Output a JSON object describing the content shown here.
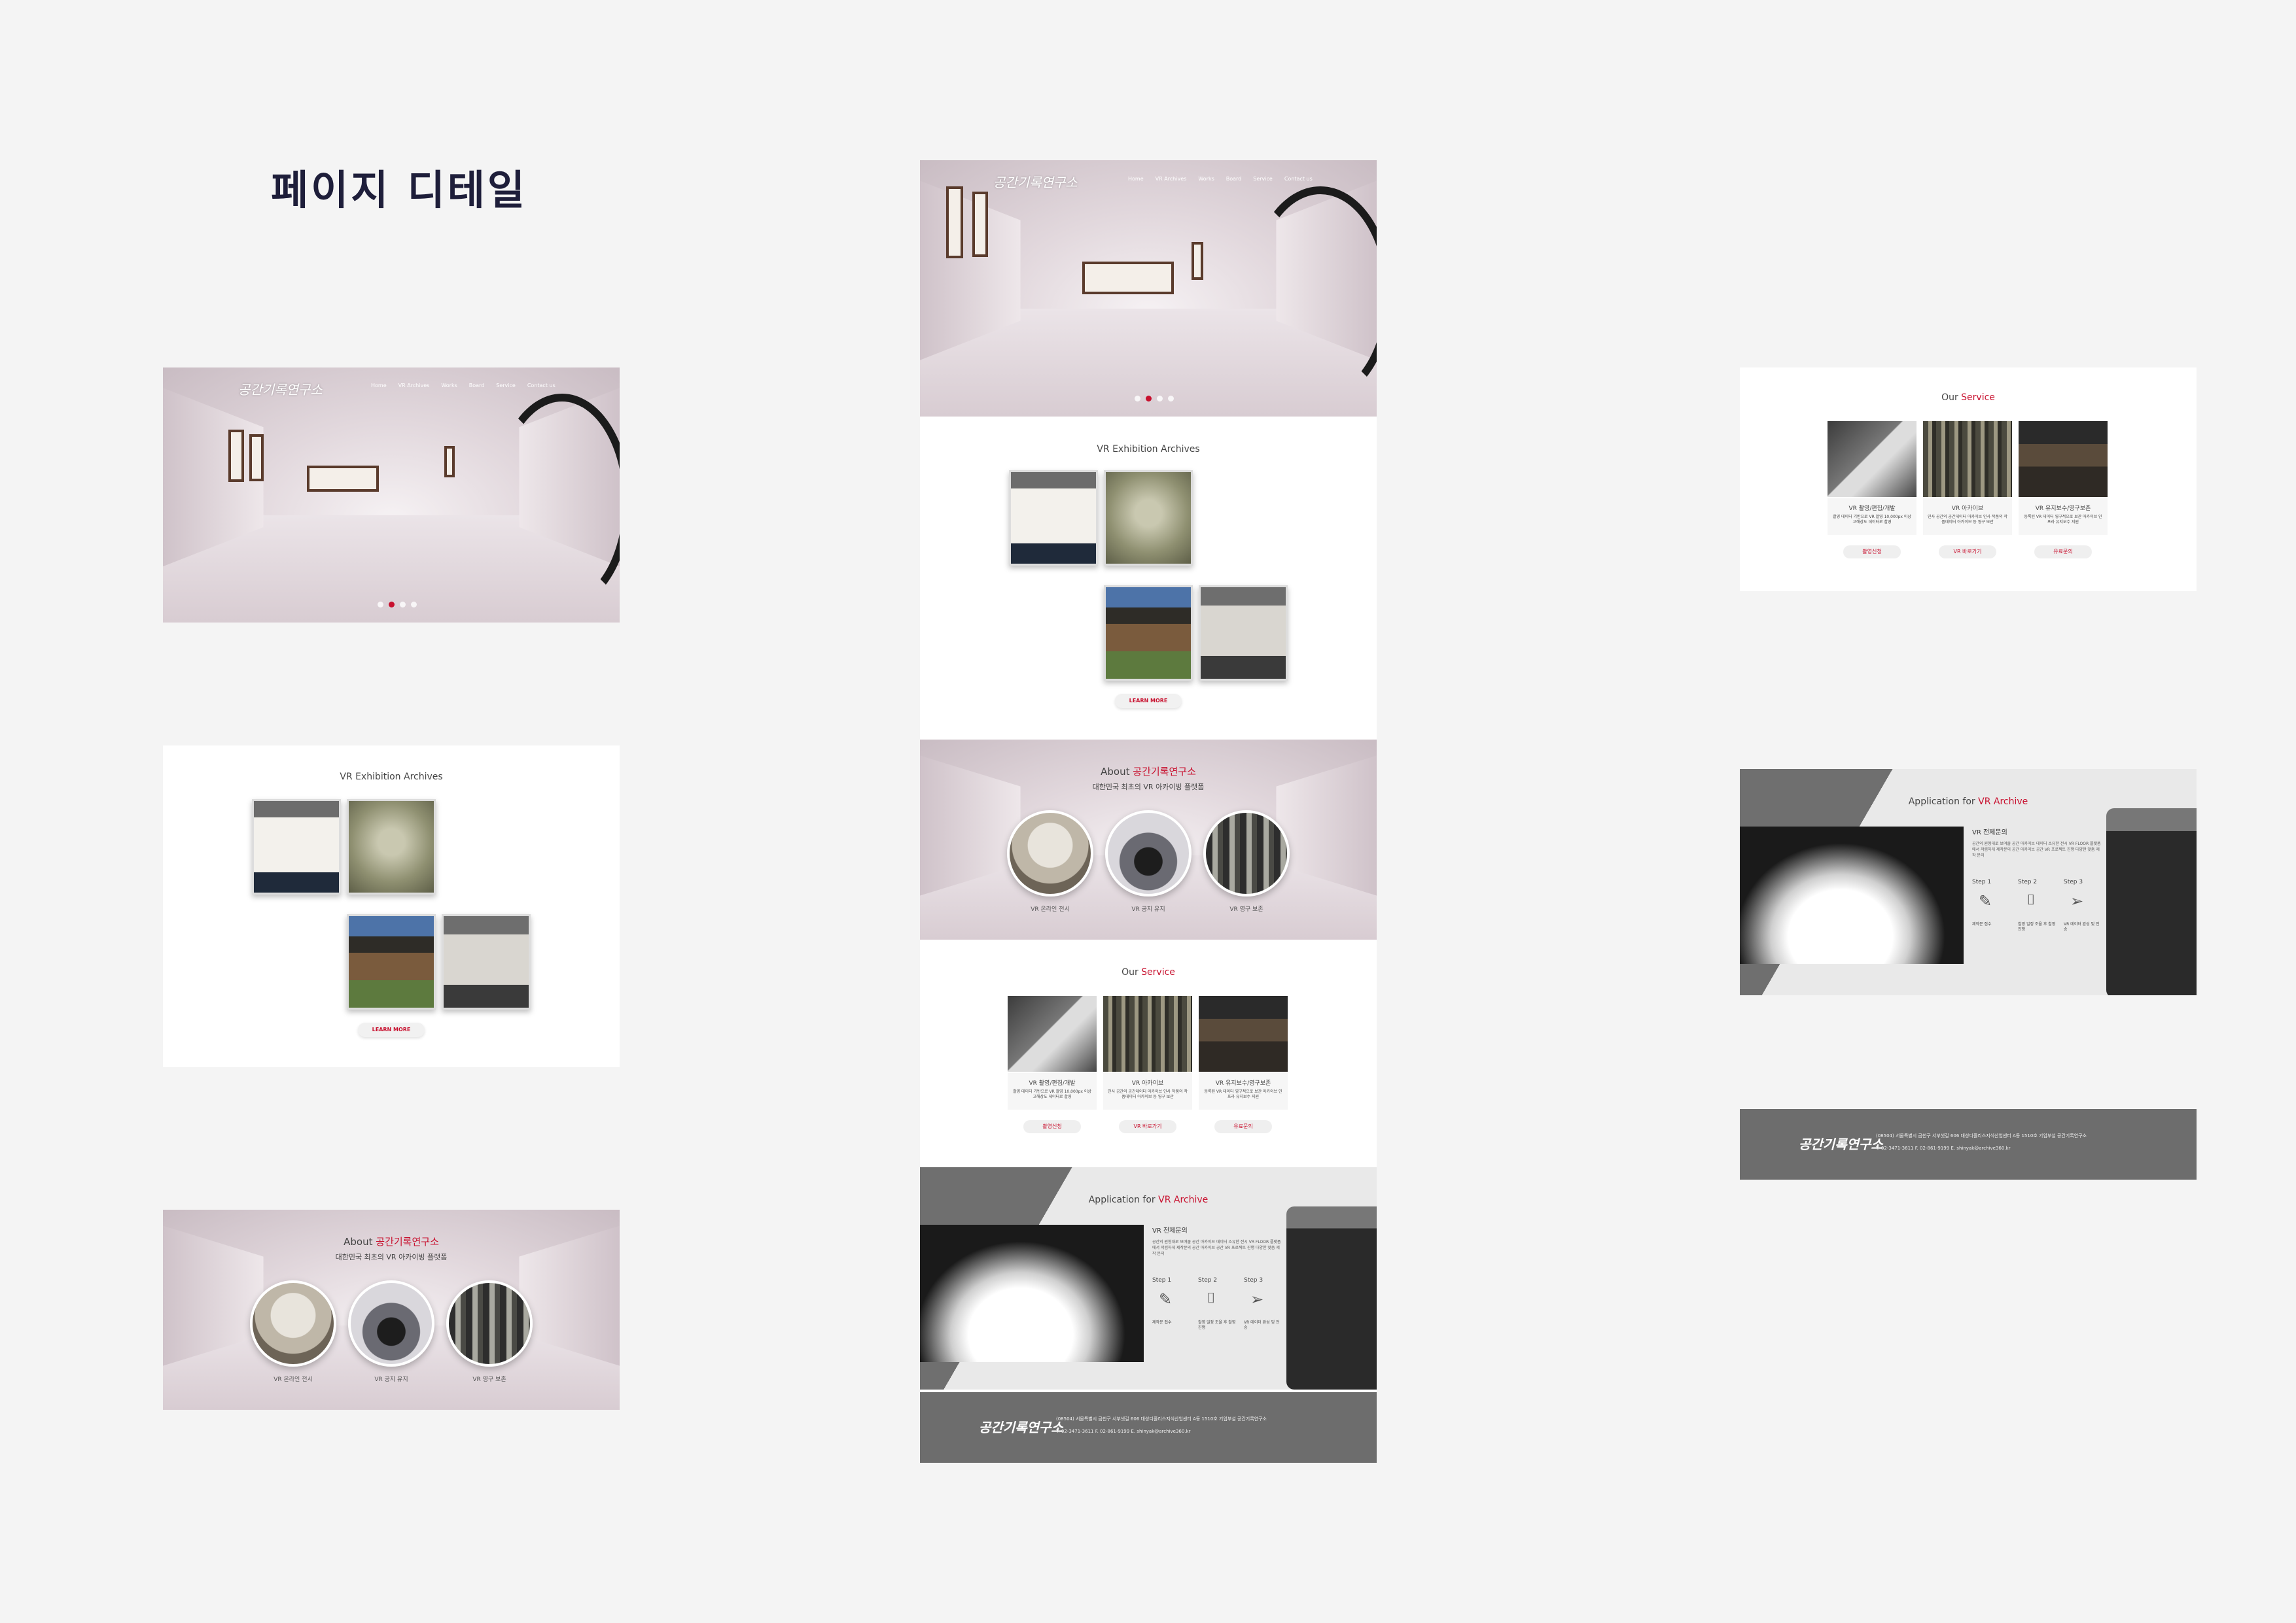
{
  "page_title": "페이지 디테일",
  "brand": {
    "logo": "공간기록연구소",
    "accent": "#c8102e",
    "footer_bg": "#6d6d6d"
  },
  "nav": [
    "Home",
    "VR Archives",
    "Works",
    "Board",
    "Service",
    "Contact us"
  ],
  "vr_section": {
    "title": "VR Exhibition Archives",
    "button": "LEARN MORE"
  },
  "about": {
    "title_prefix": "About",
    "title_highlight": "공간기록연구소",
    "subtitle": "대한민국 최초의 VR 아카이빙 플랫폼",
    "circles": [
      "VR 온라인 전시",
      "VR 공지 유지",
      "VR 영구 보존"
    ]
  },
  "service": {
    "title_prefix": "Our",
    "title_highlight": "Service",
    "items": [
      {
        "name": "VR 촬영/편집/개발",
        "desc": "촬영 데이터 기반으로 VR 촬영 10,000px 이상 고해상도 데이터로 촬영",
        "button": "촬영신청"
      },
      {
        "name": "VR 아카이브",
        "desc": "인사 공간의 공간데이터 아카이브 인사 작품의 작품데이터 아카이브 등 영구 보관",
        "button": "VR 바로가기"
      },
      {
        "name": "VR 유지보수/영구보존",
        "desc": "등록된 VR 데이터 영구적으로 보관 아카이브 인프라 유지보수 지원",
        "button": "유료문의"
      }
    ]
  },
  "application": {
    "title_prefix": "Application for",
    "title_highlight": "VR Archive",
    "subtitle": "VR 전제문의",
    "desc": "공간의 원형대로 보여줄 공간 아카이브 데이터 소유한 전시 VR FLOOR 플랫폼에서 저렴하게 제작문의 공간 아카이브 공간 VR 프로젝트 진행 다양한 맞춤 제작 문의",
    "steps": [
      {
        "label": "Step 1",
        "icon": "edit-icon",
        "text": "제작문 접수"
      },
      {
        "label": "Step 2",
        "icon": "camera-icon",
        "text": "촬영 일정 조율 후 촬영 진행"
      },
      {
        "label": "Step 3",
        "icon": "paper-plane-icon",
        "text": "VR 데이터 완성 및 전송"
      }
    ]
  },
  "footer": {
    "logo": "공간기록연구소",
    "address": "(08504) 서울특별시 금천구 서부샛길 606 대성디폴리스지식산업센터 A동 1510호 기업부설 공간기록연구소",
    "contact": "T. 02-3471-3611   F. 02-861-9199   E. shinyak@archive360.kr"
  }
}
